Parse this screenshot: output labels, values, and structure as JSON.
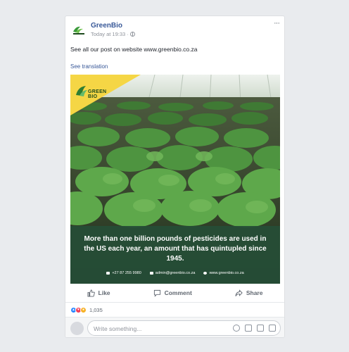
{
  "post": {
    "page_name": "GreenBio",
    "timestamp": "Today at 19:33",
    "separator": "·",
    "privacy_icon": "globe-icon",
    "more_icon": "more-options-icon",
    "more_label": "···",
    "text": "See all our post on website www.greenbio.co.za",
    "see_translation": "See translation"
  },
  "image": {
    "logo_text": "GREEN BIO",
    "caption": "More than one billion pounds of pesticides are used in the US each year, an amount that has quintupled since 1945.",
    "phone": "+27 87 255 9980",
    "email": "admin@greenbio.co.za",
    "website": "www.greenbio.co.za"
  },
  "actions": [
    {
      "label": "Like",
      "icon": "thumbs-up-icon"
    },
    {
      "label": "Comment",
      "icon": "comment-icon"
    },
    {
      "label": "Share",
      "icon": "share-icon"
    }
  ],
  "reactions": {
    "icons": [
      "like-reaction-icon",
      "love-reaction-icon",
      "wow-reaction-icon"
    ],
    "count": "1,035"
  },
  "composer": {
    "placeholder": "Write something...",
    "icons": [
      "emoji-icon",
      "camera-icon",
      "gif-icon",
      "sticker-icon"
    ]
  },
  "colors": {
    "link": "#385898",
    "background": "#e9ebee",
    "caption_band": "#264e37",
    "brand_yellow": "#f5d645"
  }
}
